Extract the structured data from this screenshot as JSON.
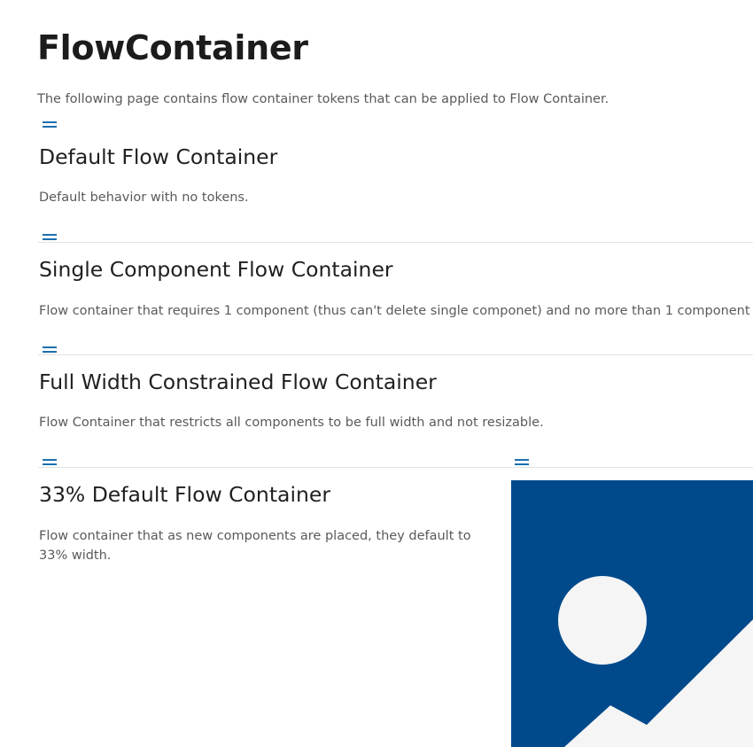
{
  "page": {
    "title": "FlowContainer",
    "intro": "The following page contains flow container tokens that can be applied to Flow Container."
  },
  "sections": [
    {
      "title": "Default Flow Container",
      "description": "Default behavior with no tokens."
    },
    {
      "title": "Single Component Flow Container",
      "description": "Flow container that requires 1 component (thus can't delete single componet) and no more than 1 component"
    },
    {
      "title": "Full Width Constrained Flow Container",
      "description": "Flow Container that restricts all components to be full width and not resizable."
    },
    {
      "title": "33% Default Flow Container",
      "description": "Flow container that as new components are placed, they default to 33% width."
    }
  ],
  "icons": {
    "drag_handle": "drag-handle-icon",
    "image_placeholder": "image-placeholder-icon"
  },
  "colors": {
    "accent": "#1b6fae",
    "image_background": "#004a8c",
    "image_foreground": "#f5f5f5",
    "divider": "#e3e3e3"
  }
}
